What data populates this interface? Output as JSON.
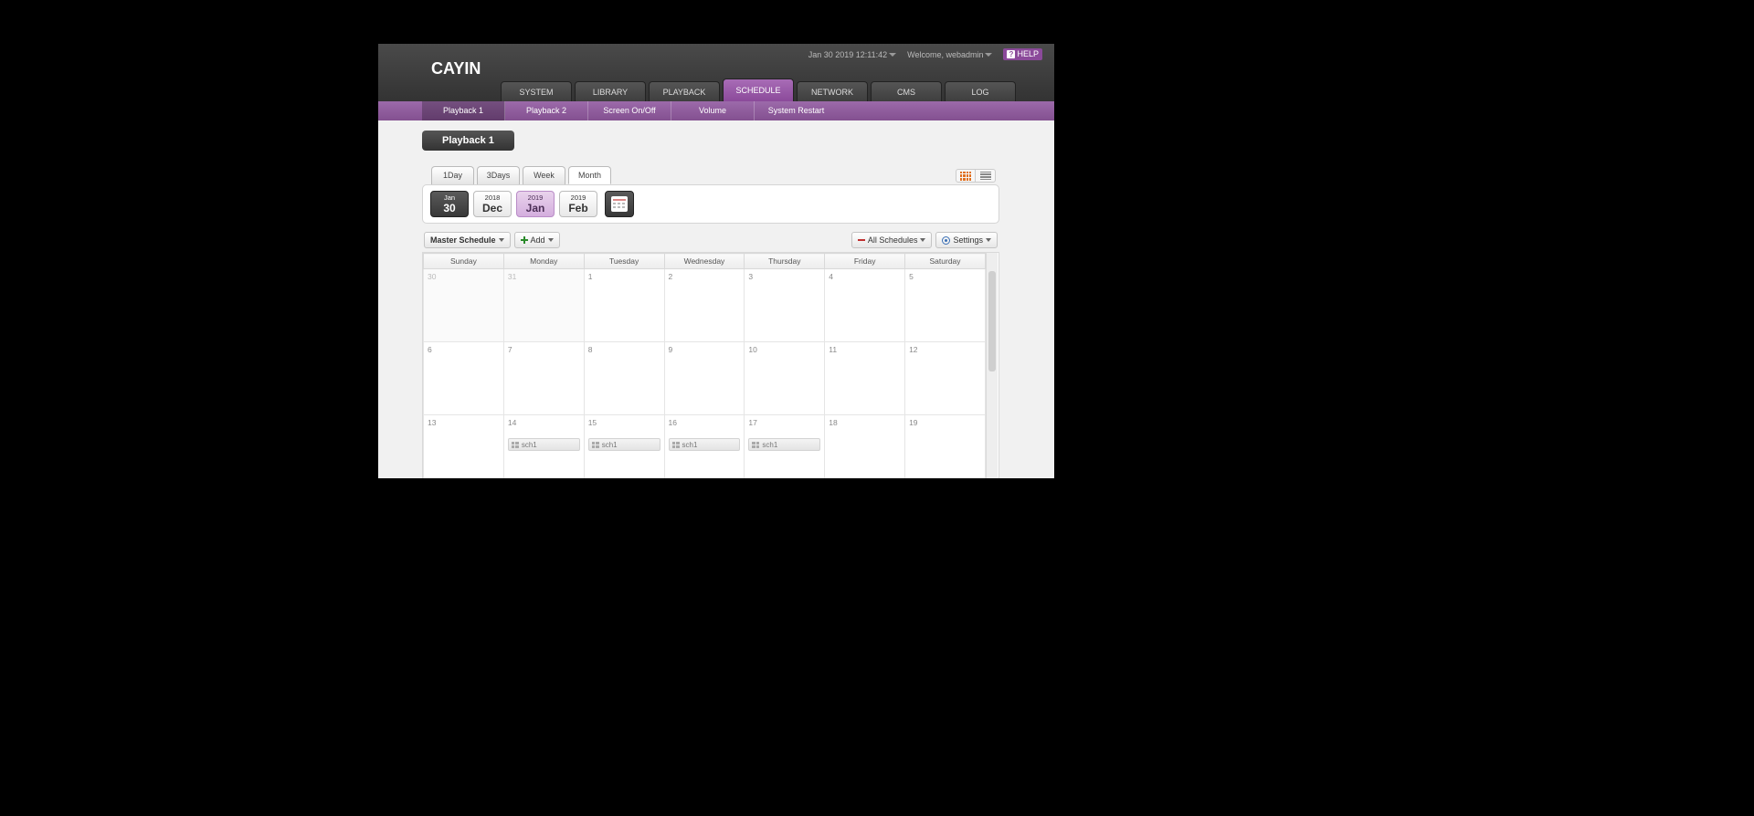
{
  "header": {
    "datetime": "Jan 30 2019 12:11:42",
    "welcome": "Welcome, webadmin",
    "help": "HELP",
    "logo": "CAYIN"
  },
  "mainnav": [
    {
      "label": "SYSTEM",
      "active": false
    },
    {
      "label": "LIBRARY",
      "active": false
    },
    {
      "label": "PLAYBACK",
      "active": false
    },
    {
      "label": "SCHEDULE",
      "active": true
    },
    {
      "label": "NETWORK",
      "active": false
    },
    {
      "label": "CMS",
      "active": false
    },
    {
      "label": "LOG",
      "active": false
    }
  ],
  "subnav": [
    "Playback 1",
    "Playback 2",
    "Screen On/Off",
    "Volume",
    "System Restart"
  ],
  "page_title": "Playback 1",
  "view_tabs": [
    {
      "label": "1Day",
      "active": false
    },
    {
      "label": "3Days",
      "active": false
    },
    {
      "label": "Week",
      "active": false
    },
    {
      "label": "Month",
      "active": true
    }
  ],
  "month_nav": {
    "today": {
      "small": "Jan",
      "big": "30"
    },
    "prev": {
      "small": "2018",
      "big": "Dec"
    },
    "curr": {
      "small": "2019",
      "big": "Jan"
    },
    "next": {
      "small": "2019",
      "big": "Feb"
    }
  },
  "toolbar": {
    "master": "Master Schedule",
    "add": "Add",
    "all": "All Schedules",
    "settings": "Settings"
  },
  "weekdays": [
    "Sunday",
    "Monday",
    "Tuesday",
    "Wednesday",
    "Thursday",
    "Friday",
    "Saturday"
  ],
  "weeks": [
    [
      {
        "n": "30",
        "out": true
      },
      {
        "n": "31",
        "out": true
      },
      {
        "n": "1"
      },
      {
        "n": "2"
      },
      {
        "n": "3"
      },
      {
        "n": "4"
      },
      {
        "n": "5"
      }
    ],
    [
      {
        "n": "6"
      },
      {
        "n": "7"
      },
      {
        "n": "8"
      },
      {
        "n": "9"
      },
      {
        "n": "10"
      },
      {
        "n": "11"
      },
      {
        "n": "12"
      }
    ],
    [
      {
        "n": "13"
      },
      {
        "n": "14",
        "ev": "sch1"
      },
      {
        "n": "15",
        "ev": "sch1"
      },
      {
        "n": "16",
        "ev": "sch1"
      },
      {
        "n": "17",
        "ev": "sch1"
      },
      {
        "n": "18"
      },
      {
        "n": "19"
      }
    ]
  ]
}
